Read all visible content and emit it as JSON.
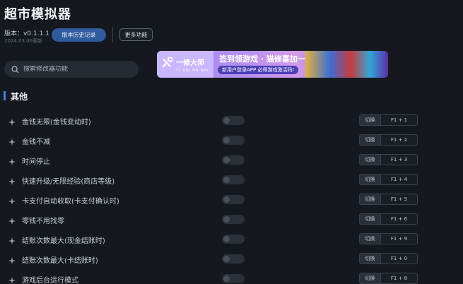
{
  "header": {
    "title": "超市模拟器",
    "version": "版本：v0.1.1.1",
    "date": "2024.03.06更新",
    "history_button": "版本历史记录",
    "more_button": "更多功能"
  },
  "search": {
    "placeholder": "搜索修改器功能"
  },
  "banner": {
    "logo_cn": "一修大师",
    "logo_pinyin": "YI XIU DA SHI",
    "headline": "签到领游戏 · 猫修喜加一",
    "subline": "新用户登录APP  必得游戏激活码!"
  },
  "section": {
    "title": "其他"
  },
  "colors": {
    "accent": "#3d82f0",
    "button": "#2f5b9f",
    "background": "#15181e"
  },
  "cheats": [
    {
      "label": "金钱无限(金钱变动时)",
      "switch": "切换",
      "hotkey": "F1 + 1",
      "enabled": false
    },
    {
      "label": "金钱不减",
      "switch": "切换",
      "hotkey": "F1 + 2",
      "enabled": false
    },
    {
      "label": "时间停止",
      "switch": "切换",
      "hotkey": "F1 + 3",
      "enabled": false
    },
    {
      "label": "快速升级/无限经验(商店等级)",
      "switch": "切换",
      "hotkey": "F1 + 4",
      "enabled": false
    },
    {
      "label": "卡支付自动收取(卡支付确认时)",
      "switch": "切换",
      "hotkey": "F1 + 5",
      "enabled": false
    },
    {
      "label": "零钱不用找零",
      "switch": "切换",
      "hotkey": "F1 + 6",
      "enabled": false
    },
    {
      "label": "结账次数最大(现金结账时)",
      "switch": "切换",
      "hotkey": "F1 + 9",
      "enabled": false
    },
    {
      "label": "结账次数最大(卡结账时)",
      "switch": "切换",
      "hotkey": "F1 + 0",
      "enabled": false
    },
    {
      "label": "游戏后台运行模式",
      "switch": "切换",
      "hotkey": "F1 + 8",
      "enabled": false
    }
  ]
}
